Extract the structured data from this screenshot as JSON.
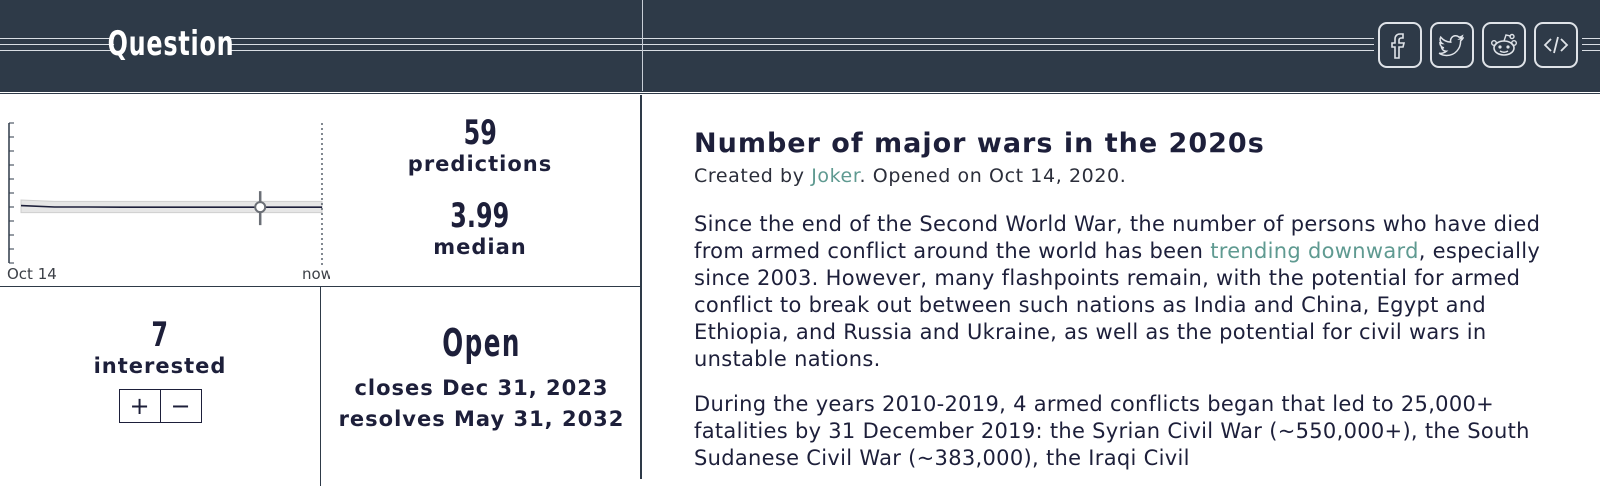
{
  "header": {
    "title": "Question",
    "share_icons": [
      "facebook-icon",
      "twitter-icon",
      "reddit-icon",
      "embed-code-icon"
    ]
  },
  "chart_data": {
    "type": "line",
    "x_tick_labels": [
      "Oct 14",
      "now"
    ],
    "series": [
      {
        "median": [
          4.1,
          4.0,
          4.0,
          3.99,
          3.99,
          3.99,
          3.99,
          3.99,
          3.99,
          3.99
        ]
      }
    ],
    "band": {
      "lower": [
        3.6,
        3.6,
        3.6,
        3.6,
        3.6,
        3.6,
        3.6,
        3.6,
        3.6,
        3.6
      ],
      "upper": [
        4.5,
        4.4,
        4.4,
        4.4,
        4.4,
        4.4,
        4.4,
        4.4,
        4.4,
        4.4
      ]
    },
    "ylim": [
      0,
      10
    ],
    "marker_fraction": 0.8,
    "grid": false
  },
  "stats": {
    "predictions_count": "59",
    "predictions_label": "predictions",
    "median_value": "3.99",
    "median_label": "median",
    "interested_count": "7",
    "interested_label": "interested",
    "status": "Open",
    "closes": "closes Dec 31, 2023",
    "resolves": "resolves May 31, 2032",
    "vote_plus": "+",
    "vote_minus": "−"
  },
  "question": {
    "title": "Number of major wars in the 2020s",
    "created_prefix": "Created by ",
    "author": "Joker",
    "opened": ". Opened on Oct 14, 2020.",
    "p1_part1": "Since the end of the Second World War, the number of persons who have died from armed conflict around the world has been ",
    "p1_link": "trending downward",
    "p1_part2": ", especially since 2003. However, many flashpoints remain, with the potential for armed conflict to break out between such nations as India and China, Egypt and Ethiopia, and Russia and Ukraine, as well as the potential for civil wars in unstable nations.",
    "p2": "During the years 2010-2019, 4 armed conflicts began that led to 25,000+ fatalities by 31 December 2019: the Syrian Civil War (~550,000+), the South Sudanese Civil War (~383,000), the Iraqi Civil"
  }
}
